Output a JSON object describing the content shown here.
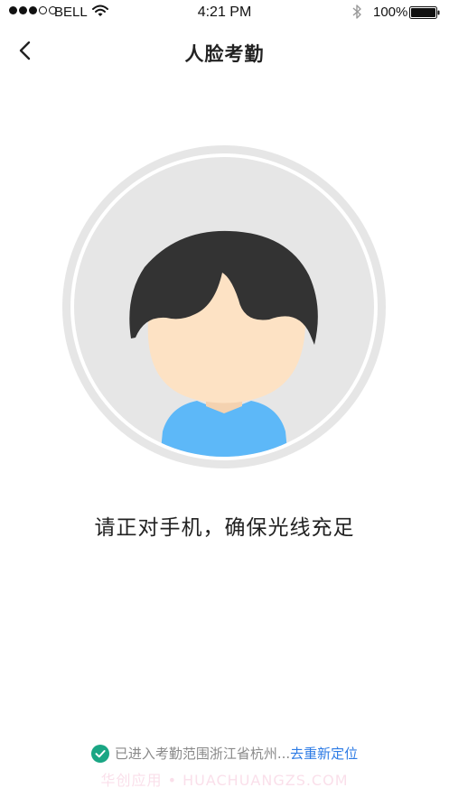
{
  "status_bar": {
    "carrier": "BELL",
    "time": "4:21 PM",
    "battery_percent": "100%",
    "signal_bars_filled": 3,
    "signal_bars_total": 5
  },
  "nav": {
    "title": "人脸考勤",
    "back_icon": "chevron-left-icon"
  },
  "main": {
    "avatar_icon": "face-avatar-illustration",
    "instruction": "请正对手机，确保光线充足"
  },
  "location": {
    "status_icon": "check-circle-icon",
    "status_text": "已进入考勤范围浙江省杭州...",
    "relocate_label": "去重新定位"
  },
  "watermark": "华创应用 • HUACHUANGZS.COM",
  "colors": {
    "accent_link": "#2d7be5",
    "check_green": "#1aa684",
    "hair": "#333333",
    "skin": "#fde2c4",
    "shirt": "#5db8f8",
    "ring": "#e6e6e6"
  }
}
